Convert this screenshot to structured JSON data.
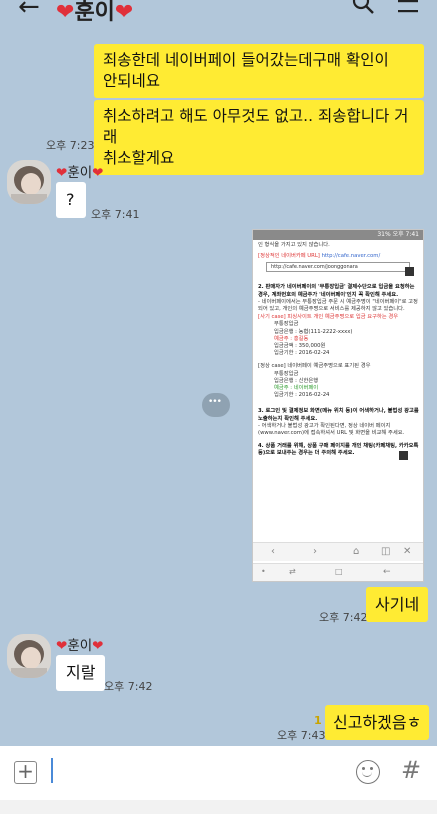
{
  "header": {
    "back_icon": "arrow-left-icon",
    "title": "훈이",
    "title_heart": "❤",
    "search_icon": "search-icon",
    "menu_icon": "hamburger-menu-icon"
  },
  "messages": [
    {
      "from": "me",
      "text_line1": "죄송한데 네이버페이 들어갔는데구매 확인이",
      "text_line2": "안되네요"
    },
    {
      "from": "me",
      "text_line1": "취소하려고 해도 아무것도 없고.. 죄송합니다 거래",
      "text_line2": "취소할게요",
      "time": "오후 7:23"
    },
    {
      "from": "other",
      "sender": "훈이",
      "text": "?",
      "time": "오후 7:41"
    },
    {
      "from": "me",
      "type": "image",
      "time": "오후 7:42"
    },
    {
      "from": "me",
      "text": "사기네"
    },
    {
      "from": "other",
      "sender": "훈이",
      "text": "지랄",
      "time": "오후 7:42"
    },
    {
      "from": "me",
      "text": "신고하겠음ㅎ",
      "time": "오후 7:43",
      "unread": "1"
    }
  ],
  "embedded_screenshot": {
    "status": "31% 오후 7:41",
    "intro": "인 형식을 가지고 있지 않습니다.",
    "legit_url_label": "[정상적인 네이버카페 URL]",
    "legit_url": "http://cafe.naver.com/",
    "urlbar_text": "http://cafe.naver.com/joonggonara",
    "point2_title": "2. 판매자가 네이버페이의 '무통장입금' 결제수단으로 입금을 요청하는 경우, 계좌번호의 예금주가 '네이버페이'인지 꼭 확인해 주세요.",
    "point2_body": "- 네이버페이에서는 무통장입금 주문 시 예금주명이 \"네이버페이\"로 고정되어 있고, 개인의 예금주명으로 서비스를 제공하지 않고 있습니다.",
    "scam_case": "[사기 case] 피싱사이트 개인 예금주명으로 입금 요구하는 경우",
    "scam_lines": [
      "무통장입금",
      "입금은행 : 농협(111-2222-xxxx)",
      "예금주 : 홍길동",
      "입금금액 : 350,000원",
      "입금기한 : 2016-02-24"
    ],
    "normal_case": "[정상 case] 네이버페이 예금주명으로 표기된 경우",
    "normal_lines": [
      "무통장입금",
      "입금은행 : 신한은행",
      "예금주 : 네이버페이",
      "입금기한 : 2016-02-24"
    ],
    "point3_title": "3. 로그인 및 결제정보 화면(메뉴 위치 등)이 어색하거나, 불법성 광고를 노출하는지 확인해 주세요.",
    "point3_body": "- 어색하거나 불법성 광고가 확인된다면, 정상 네이버 페이지(www.naver.com)에 접속하셔서 URL 및 화면을 비교해 주세요.",
    "point4_title": "4. 상품 거래를 위해, 상품 구매 페이지를 개인 채팅(카페채팅, 카카오톡 등)으로 보내주는 경우는 더 주의해 주세요."
  },
  "input": {
    "plus_icon": "plus-icon",
    "emoji_icon": "emoji-icon",
    "hash_icon": "hash-icon"
  }
}
